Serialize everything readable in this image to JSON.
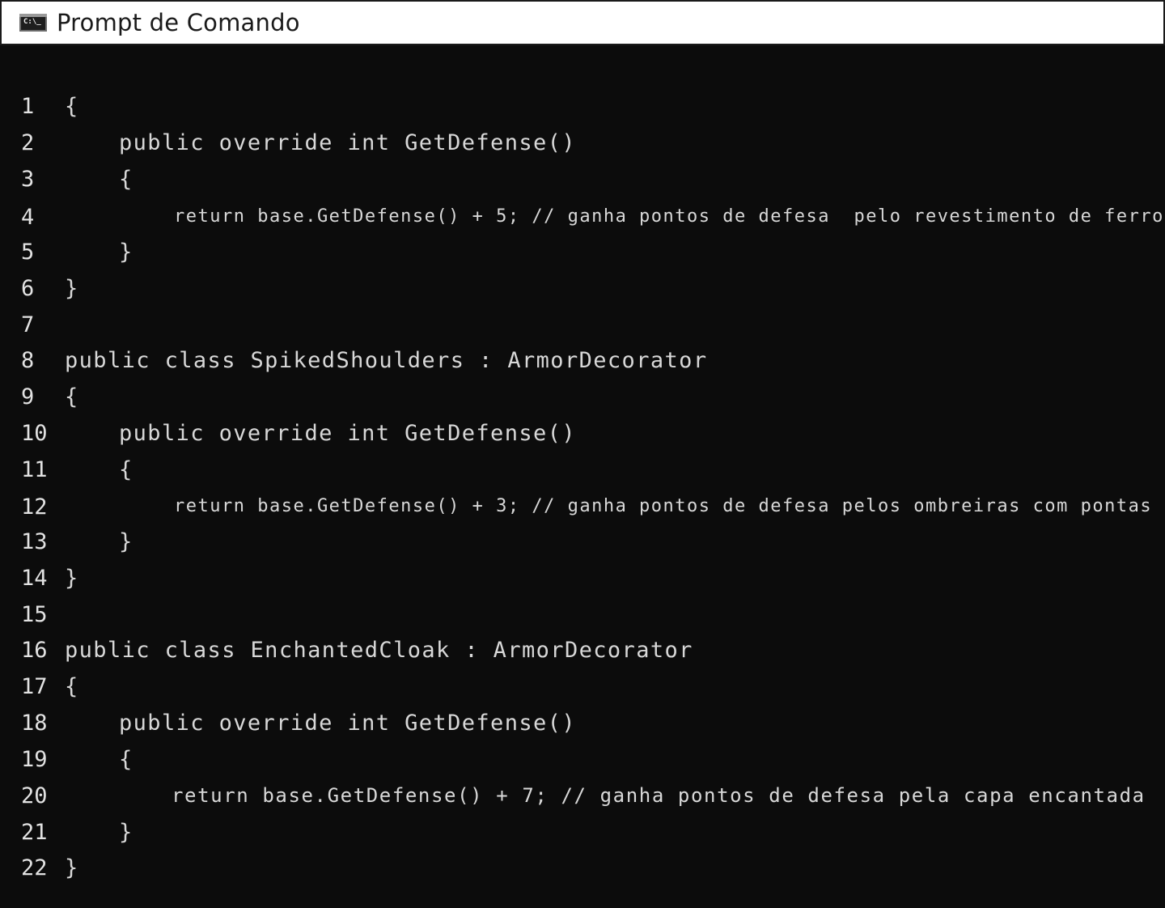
{
  "window": {
    "title": "Prompt de Comando",
    "icon": "C:\\_"
  },
  "code": {
    "lines": [
      {
        "n": "1",
        "text": "{"
      },
      {
        "n": "2",
        "text": "public override int GetDefense()"
      },
      {
        "n": "3",
        "text": "{"
      },
      {
        "n": "4",
        "text": "return base.GetDefense() + 5; // ganha pontos de defesa  pelo revestimento de ferro"
      },
      {
        "n": "5",
        "text": "}"
      },
      {
        "n": "6",
        "text": "}"
      },
      {
        "n": "7",
        "text": ""
      },
      {
        "n": "8",
        "text": "public class SpikedShoulders : ArmorDecorator"
      },
      {
        "n": "9",
        "text": "{"
      },
      {
        "n": "10",
        "text": "public override int GetDefense()"
      },
      {
        "n": "11",
        "text": "{"
      },
      {
        "n": "12",
        "text": "return base.GetDefense() + 3; // ganha pontos de defesa pelos ombreiras com pontas"
      },
      {
        "n": "13",
        "text": "}"
      },
      {
        "n": "14",
        "text": "}"
      },
      {
        "n": "15",
        "text": ""
      },
      {
        "n": "16",
        "text": "public class EnchantedCloak : ArmorDecorator"
      },
      {
        "n": "17",
        "text": "{"
      },
      {
        "n": "18",
        "text": "public override int GetDefense()"
      },
      {
        "n": "19",
        "text": "{"
      },
      {
        "n": "20",
        "text": "return base.GetDefense() + 7; // ganha pontos de defesa pela capa encantada"
      },
      {
        "n": "21",
        "text": "}"
      },
      {
        "n": "22",
        "text": "}"
      }
    ]
  },
  "colors": {
    "background": "#0c0c0c",
    "text": "#d8d8d8",
    "titlebar": "#ffffff"
  }
}
